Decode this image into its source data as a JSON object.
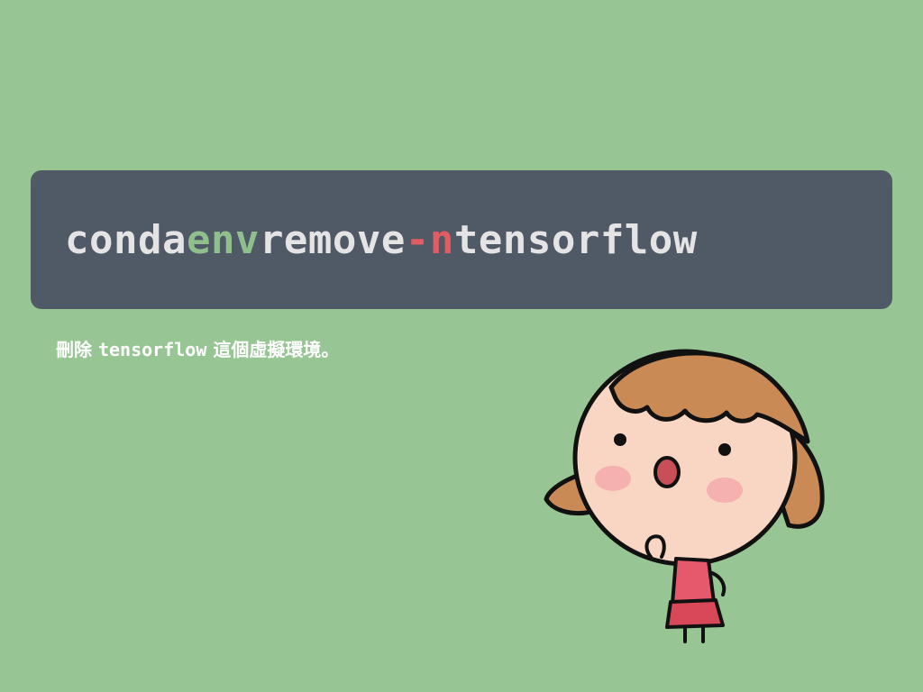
{
  "colors": {
    "background": "#97c694",
    "code_box": "#505966",
    "command_text": "#e4e4e4",
    "subcommand_text": "#8fbf8c",
    "flag_text": "#e25c63",
    "caption_text": "#ffffff"
  },
  "command": {
    "program": "conda",
    "subcommand": "env",
    "action": "remove",
    "flag": "-n",
    "target": "tensorflow"
  },
  "caption": {
    "prefix": "刪除 ",
    "env_name": "tensorflow",
    "suffix": " 這個虛擬環境。"
  },
  "illustration": {
    "icon": "girl-character-icon"
  }
}
